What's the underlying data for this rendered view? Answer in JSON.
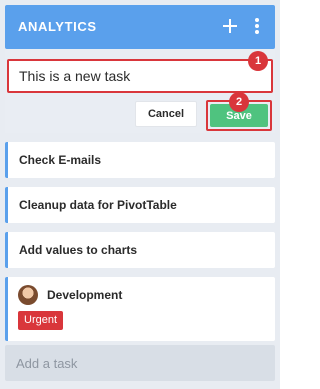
{
  "header": {
    "title": "ANALYTICS",
    "add_icon": "plus-icon",
    "menu_icon": "more-vertical-icon",
    "color": "#5aa0ec"
  },
  "editor": {
    "input_value": "This is a new task",
    "cancel_label": "Cancel",
    "save_label": "Save",
    "highlight_color": "#d9363b",
    "save_color": "#4fc37f"
  },
  "badges": [
    "1",
    "2"
  ],
  "tasks": [
    {
      "label": "Check E-mails"
    },
    {
      "label": "Cleanup data for PivotTable"
    },
    {
      "label": "Add values to charts"
    }
  ],
  "development_card": {
    "label": "Development",
    "tag": "Urgent",
    "tag_color": "#d9363b",
    "avatar": "user-avatar"
  },
  "footer": {
    "add_task_label": "Add a task"
  }
}
